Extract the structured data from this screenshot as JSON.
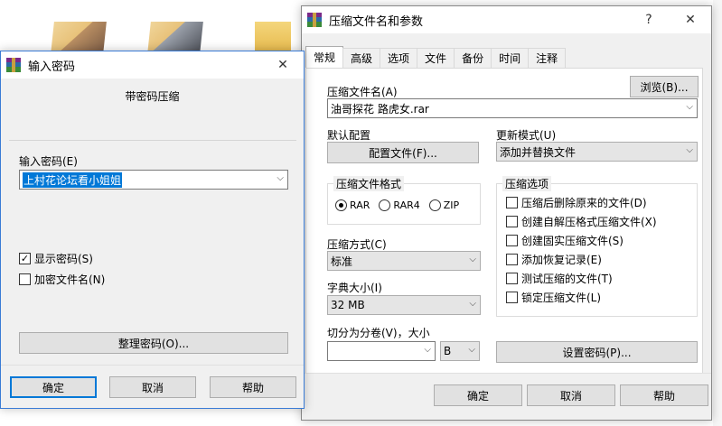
{
  "main_dialog": {
    "title": "压缩文件名和参数",
    "help_btn": "?",
    "close_btn": "✕",
    "tabs": [
      {
        "label": "常规"
      },
      {
        "label": "高级"
      },
      {
        "label": "选项"
      },
      {
        "label": "文件"
      },
      {
        "label": "备份"
      },
      {
        "label": "时间"
      },
      {
        "label": "注释"
      }
    ],
    "archive_name_label": "压缩文件名(A)",
    "browse_btn": "浏览(B)...",
    "archive_name_value": "油哥探花 路虎女.rar",
    "default_profile_label": "默认配置",
    "profile_btn": "配置文件(F)...",
    "update_mode_label": "更新模式(U)",
    "update_mode_value": "添加并替换文件",
    "format_group_title": "压缩文件格式",
    "formats": [
      {
        "label": "RAR"
      },
      {
        "label": "RAR4"
      },
      {
        "label": "ZIP"
      }
    ],
    "method_label": "压缩方式(C)",
    "method_value": "标准",
    "dict_label": "字典大小(I)",
    "dict_value": "32 MB",
    "split_label": "切分为分卷(V)，大小",
    "split_value": "",
    "split_unit": "B",
    "options_group_title": "压缩选项",
    "options": [
      {
        "label": "压缩后删除原来的文件(D)"
      },
      {
        "label": "创建自解压格式压缩文件(X)"
      },
      {
        "label": "创建固实压缩文件(S)"
      },
      {
        "label": "添加恢复记录(E)"
      },
      {
        "label": "测试压缩的文件(T)"
      },
      {
        "label": "锁定压缩文件(L)"
      }
    ],
    "set_password_btn": "设置密码(P)...",
    "ok_btn": "确定",
    "cancel_btn": "取消",
    "help_footer_btn": "帮助"
  },
  "password_dialog": {
    "title": "输入密码",
    "close_btn": "✕",
    "heading": "带密码压缩",
    "password_label": "输入密码(E)",
    "password_value": "上村花论坛看小姐姐",
    "show_password_label": "显示密码(S)",
    "encrypt_names_label": "加密文件名(N)",
    "organize_btn": "整理密码(O)...",
    "ok_btn": "确定",
    "cancel_btn": "取消",
    "help_btn": "帮助"
  },
  "checkmark": "✓",
  "chevron": "⌵"
}
